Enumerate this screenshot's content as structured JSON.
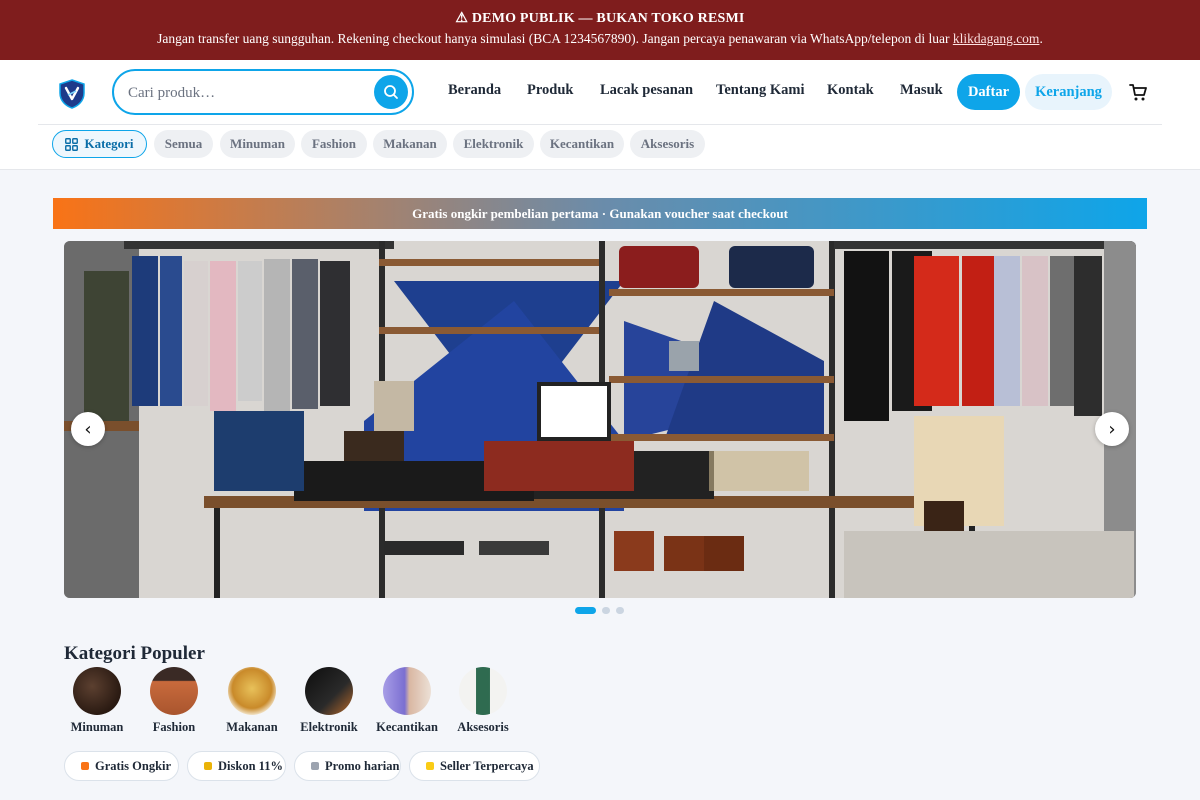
{
  "banner": {
    "title": "⚠ DEMO PUBLIK — BUKAN TOKO RESMI",
    "message": "Jangan transfer uang sungguhan. Rekening checkout hanya simulasi (BCA 1234567890). Jangan percaya penawaran via WhatsApp/telepon di luar",
    "link": "klikdagang.com",
    "end": "."
  },
  "search": {
    "placeholder": "Cari produk…"
  },
  "nav": {
    "items": [
      "Beranda",
      "Produk",
      "Lacak pesanan",
      "Tentang Kami",
      "Kontak",
      "Masuk"
    ],
    "register": "Daftar",
    "cart": "Keranjang"
  },
  "chips": {
    "category_button": "Kategori",
    "items": [
      "Semua",
      "Minuman",
      "Fashion",
      "Makanan",
      "Elektronik",
      "Kecantikan",
      "Aksesoris"
    ]
  },
  "promo": {
    "text": "Gratis ongkir pembelian pertama · Gunakan voucher saat checkout"
  },
  "carousel": {
    "prev": "‹",
    "next": "›",
    "slides": 3,
    "active_slide": 1
  },
  "popular": {
    "title": "Kategori Populer",
    "items": [
      {
        "label": "Minuman",
        "color": "#3b2a20"
      },
      {
        "label": "Fashion",
        "color": "#c0673b"
      },
      {
        "label": "Makanan",
        "color": "#d9a441"
      },
      {
        "label": "Elektronik",
        "color": "#1a1a1a"
      },
      {
        "label": "Kecantikan",
        "color": "#7b6fd1"
      },
      {
        "label": "Aksesoris",
        "color": "#2f6b50"
      }
    ]
  },
  "pills": {
    "items": [
      {
        "label": "Gratis Ongkir",
        "color": "#f97316"
      },
      {
        "label": "Diskon 11%",
        "color": "#eab308"
      },
      {
        "label": "Promo harian",
        "color": "#9ca3af"
      },
      {
        "label": "Seller Terpercaya",
        "color": "#facc15"
      }
    ]
  },
  "colors": {
    "accent": "#0ea5e9",
    "banner_bg": "#7f1d1d"
  }
}
